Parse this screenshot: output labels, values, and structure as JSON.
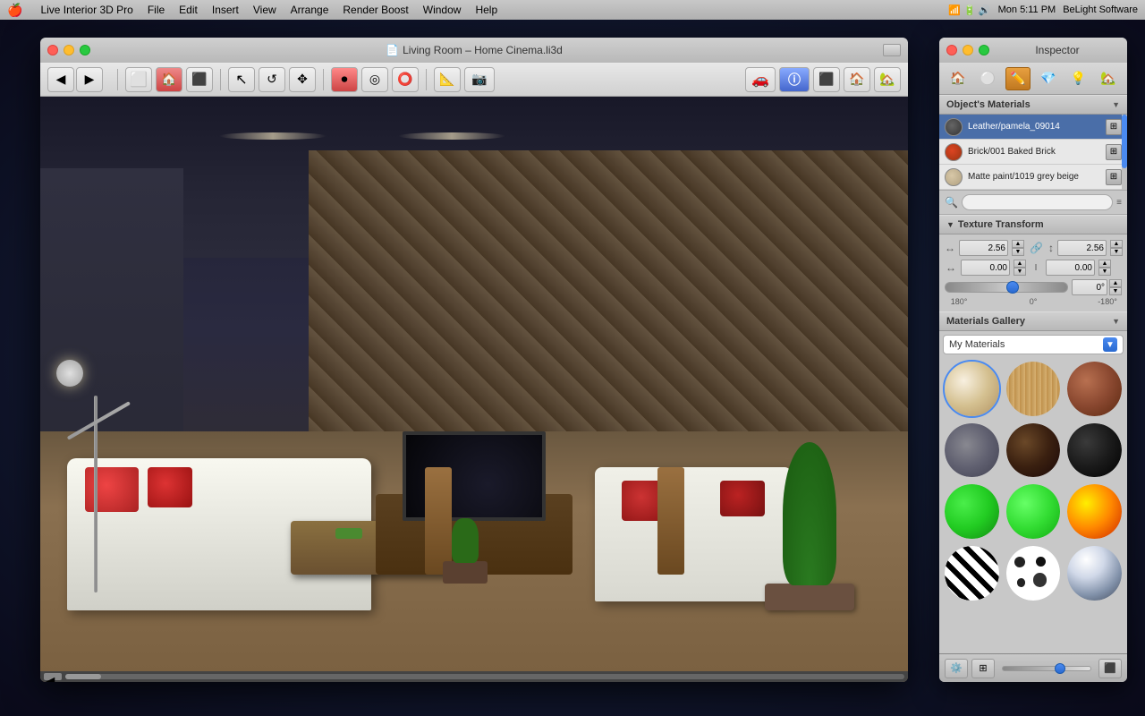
{
  "menubar": {
    "apple": "🍎",
    "items": [
      {
        "label": "Live Interior 3D Pro"
      },
      {
        "label": "File"
      },
      {
        "label": "Edit"
      },
      {
        "label": "Insert"
      },
      {
        "label": "View"
      },
      {
        "label": "Arrange"
      },
      {
        "label": "Render Boost"
      },
      {
        "label": "Window"
      },
      {
        "label": "Help"
      }
    ],
    "right": {
      "time": "Mon 5:11 PM",
      "company": "BeLight Software"
    }
  },
  "main_window": {
    "title": "Living Room – Home Cinema.li3d",
    "traffic_lights": [
      "close",
      "minimize",
      "maximize"
    ]
  },
  "inspector": {
    "title": "Inspector",
    "tabs": [
      {
        "icon": "🏠",
        "label": "room"
      },
      {
        "icon": "⚪",
        "label": "material"
      },
      {
        "icon": "✏️",
        "label": "edit",
        "active": true
      },
      {
        "icon": "💎",
        "label": "render"
      },
      {
        "icon": "💡",
        "label": "light"
      },
      {
        "icon": "🏡",
        "label": "object"
      }
    ],
    "objects_materials_title": "Object's Materials",
    "materials": [
      {
        "name": "Leather/pamela_09014",
        "color": "#555555",
        "type": "leather"
      },
      {
        "name": "Brick/001 Baked Brick",
        "color": "#cc3322",
        "type": "brick"
      },
      {
        "name": "Matte paint/1019 grey beige",
        "color": "#d4c4a8",
        "type": "paint"
      }
    ],
    "texture_transform": {
      "title": "Texture Transform",
      "scale_x": "2.56",
      "scale_y": "2.56",
      "offset_x": "0.00",
      "offset_y": "0.00",
      "rotation": "0°",
      "slider_labels": {
        "left": "180°",
        "center": "0°",
        "right": "-180°"
      }
    },
    "gallery": {
      "title": "Materials Gallery",
      "dropdown_label": "My Materials",
      "items": [
        {
          "type": "cream",
          "class": "mat-cream"
        },
        {
          "type": "wood-light",
          "class": "mat-wood-light"
        },
        {
          "type": "brick",
          "class": "mat-brick"
        },
        {
          "type": "stone",
          "class": "mat-stone"
        },
        {
          "type": "dark-wood",
          "class": "mat-dark-wood"
        },
        {
          "type": "black",
          "class": "mat-black"
        },
        {
          "type": "green",
          "class": "mat-green"
        },
        {
          "type": "bright-green",
          "class": "mat-bright-green"
        },
        {
          "type": "fire",
          "class": "mat-fire"
        },
        {
          "type": "zebra",
          "class": "mat-zebra"
        },
        {
          "type": "spots",
          "class": "mat-spots"
        },
        {
          "type": "chrome",
          "class": "mat-chrome"
        }
      ]
    }
  }
}
